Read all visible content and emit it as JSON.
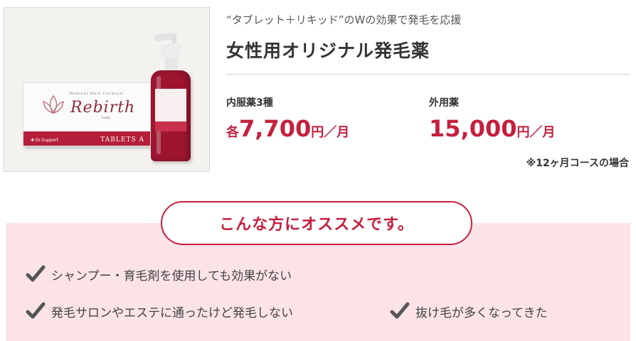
{
  "product": {
    "image": {
      "brand_small": "Medical Hair Cocktail",
      "brand_name": "Rebirth",
      "brand_sub": "Lady",
      "maker": "✚ Dr.Support",
      "tablets_label": "TABLETS A",
      "icon": "lotus-logo"
    },
    "tagline": "“タブレット＋リキッド”のWの効果で発毛を応援",
    "title": "女性用オリジナル発毛薬",
    "prices": [
      {
        "label": "内服薬3種",
        "prefix": "各",
        "amount": "7,700",
        "unit": "円／月"
      },
      {
        "label": "外用薬",
        "prefix": "",
        "amount": "15,000",
        "unit": "円／月"
      }
    ],
    "note": "※12ヶ月コースの場合"
  },
  "recommend": {
    "heading": "こんな方にオススメです。",
    "items": [
      {
        "text": "シャンプー・育毛剤を使用しても効果がない",
        "icon": "check-icon"
      },
      {
        "text": "発毛サロンやエステに通ったけど発毛しない",
        "icon": "check-icon"
      },
      {
        "text": "抜け毛が多くなってきた",
        "icon": "check-icon"
      }
    ]
  },
  "colors": {
    "accent": "#c4203e",
    "section_bg": "#fbe3e7",
    "check": "#555555"
  }
}
